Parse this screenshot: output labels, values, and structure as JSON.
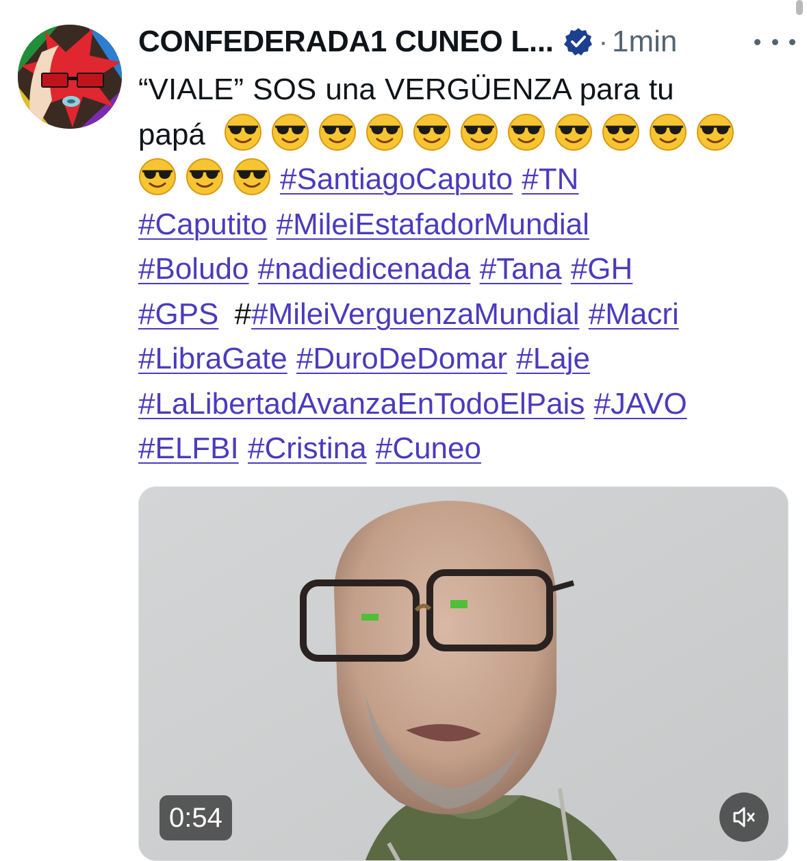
{
  "tweet": {
    "display_name": "CONFEDERADA1 CUNEO L...",
    "separator": "·",
    "time": "1min",
    "verified": true,
    "accent_color": "#4b3bbd",
    "verified_color": "#1d3f8f",
    "text": {
      "quote": "“VIALE” SOS una VERGÜENZA para tu",
      "papa": "papá",
      "emoji": "sunglasses-emoji",
      "emoji_count": 14,
      "hashtags": [
        "#SantiagoCaputo",
        "#TN",
        "#Caputito",
        "#MileiEstafadorMundial",
        "#Boludo",
        "#nadiedicenada",
        "#Tana",
        "#GH",
        "#GPS",
        "#MileiVerguenzaMundial",
        "#Macri",
        "#LibraGate",
        "#DuroDeDomar",
        "#Laje",
        "#LaLibertadAvanzaEnTodoElPais",
        "#JAVO",
        "#ELFBI",
        "#Cristina",
        "#Cuneo"
      ],
      "stray_hash": "#"
    },
    "video": {
      "duration": "0:54",
      "mute_icon": "speaker-muted-icon"
    },
    "more_icon": "more-options-icon"
  }
}
